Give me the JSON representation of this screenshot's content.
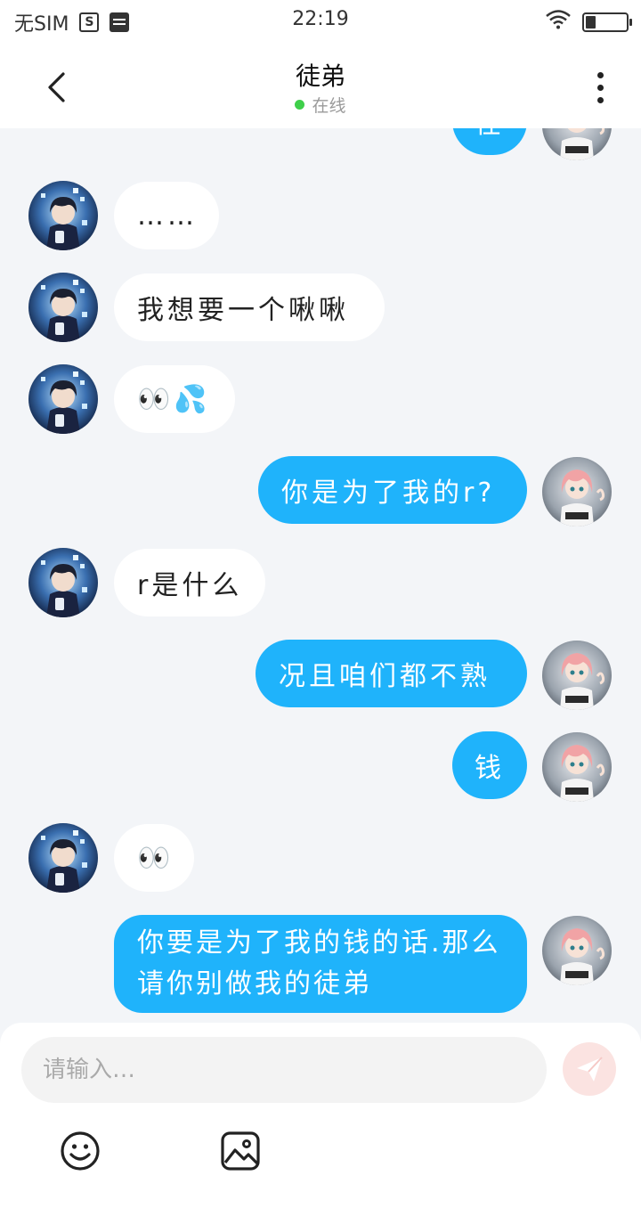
{
  "status_bar": {
    "carrier": "无SIM",
    "time": "22:19",
    "battery_level": 0.25
  },
  "header": {
    "title": "徒弟",
    "presence": "在线",
    "presence_color": "#3fcf4a"
  },
  "colors": {
    "outgoing_bubble": "#1fb3fb",
    "incoming_bubble": "#ffffff",
    "background": "#f3f5f8",
    "send_button": "#fbe3e1"
  },
  "messages": [
    {
      "from": "me",
      "text": "在"
    },
    {
      "from": "them",
      "text": "……"
    },
    {
      "from": "them",
      "text": "我想要一个啾啾"
    },
    {
      "from": "them",
      "text": "👀💦"
    },
    {
      "from": "me",
      "text": "你是为了我的r?"
    },
    {
      "from": "them",
      "text": "r是什么"
    },
    {
      "from": "me",
      "text": "况且咱们都不熟"
    },
    {
      "from": "me",
      "text": "钱"
    },
    {
      "from": "them",
      "text": "👀"
    },
    {
      "from": "me",
      "text": "你要是为了我的钱的话.那么请你别做我的徒弟"
    }
  ],
  "composer": {
    "placeholder": "请输入…",
    "icons": [
      "send-icon",
      "emoji-icon",
      "image-icon"
    ]
  }
}
